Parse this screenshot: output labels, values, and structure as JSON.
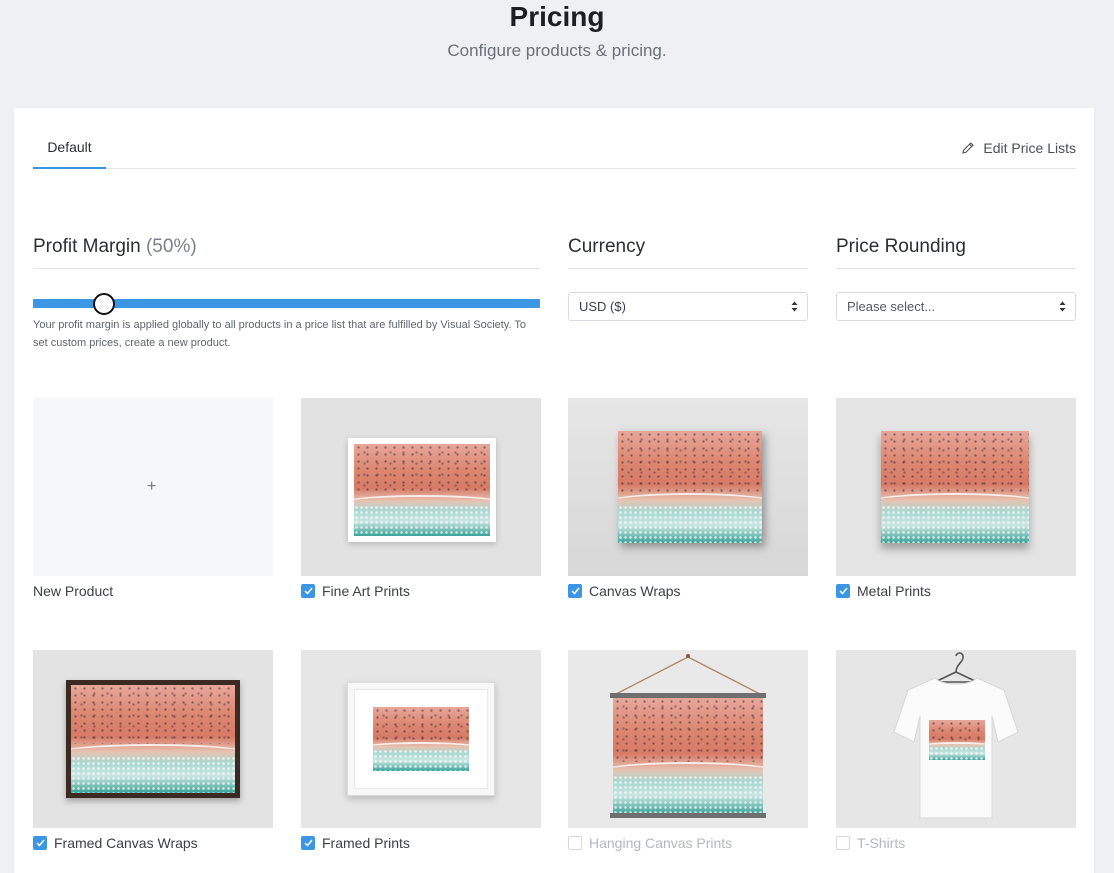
{
  "header": {
    "title": "Pricing",
    "subtitle": "Configure products & pricing."
  },
  "tabs": {
    "active_label": "Default",
    "edit_label": "Edit Price Lists"
  },
  "settings": {
    "profit_margin": {
      "title": "Profit Margin",
      "value_label": "(50%)",
      "value_fraction": 0.14,
      "help_text": "Your profit margin is applied globally to all products in a price list that are fulfilled by Visual Society. To set custom prices, create a new product."
    },
    "currency": {
      "title": "Currency",
      "selected": "USD ($)"
    },
    "rounding": {
      "title": "Price Rounding",
      "selected": "Please select..."
    }
  },
  "products": [
    {
      "label": "New Product",
      "checked": null
    },
    {
      "label": "Fine Art Prints",
      "checked": true
    },
    {
      "label": "Canvas Wraps",
      "checked": true
    },
    {
      "label": "Metal Prints",
      "checked": true
    },
    {
      "label": "Framed Canvas Wraps",
      "checked": true
    },
    {
      "label": "Framed Prints",
      "checked": true
    },
    {
      "label": "Hanging Canvas Prints",
      "checked": false
    },
    {
      "label": "T-Shirts",
      "checked": false
    }
  ],
  "colors": {
    "accent": "#3b97e3",
    "background": "#eef0f4"
  }
}
